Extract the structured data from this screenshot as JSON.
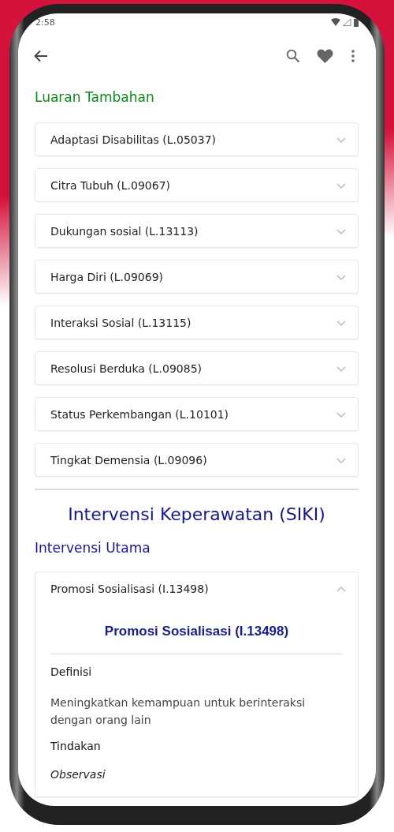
{
  "status_bar": {
    "time": "2:58"
  },
  "outcomes": {
    "title": "Luaran Tambahan",
    "items": [
      {
        "label": "Adaptasi Disabilitas (L.05037)",
        "expanded": false
      },
      {
        "label": "Citra Tubuh (L.09067)",
        "expanded": false
      },
      {
        "label": "Dukungan sosial (L.13113)",
        "expanded": false
      },
      {
        "label": "Harga Diri (L.09069)",
        "expanded": false
      },
      {
        "label": "Interaksi Sosial (L.13115)",
        "expanded": false
      },
      {
        "label": "Resolusi Berduka (L.09085)",
        "expanded": false
      },
      {
        "label": "Status Perkembangan (L.10101)",
        "expanded": false
      },
      {
        "label": "Tingkat Demensia (L.09096)",
        "expanded": false
      }
    ]
  },
  "interventions": {
    "heading": "Intervensi Keperawatan (SIKI)",
    "subheading": "Intervensi Utama",
    "items": [
      {
        "label": "Promosi Sosialisasi (I.13498)",
        "expanded": true,
        "detail": {
          "title": "Promosi Sosialisasi (I.13498)",
          "definition_label": "Definisi",
          "definition": "Meningkatkan kemampuan untuk berinteraksi dengan orang lain",
          "actions_label": "Tindakan",
          "subsection": "Observasi"
        }
      }
    ]
  }
}
